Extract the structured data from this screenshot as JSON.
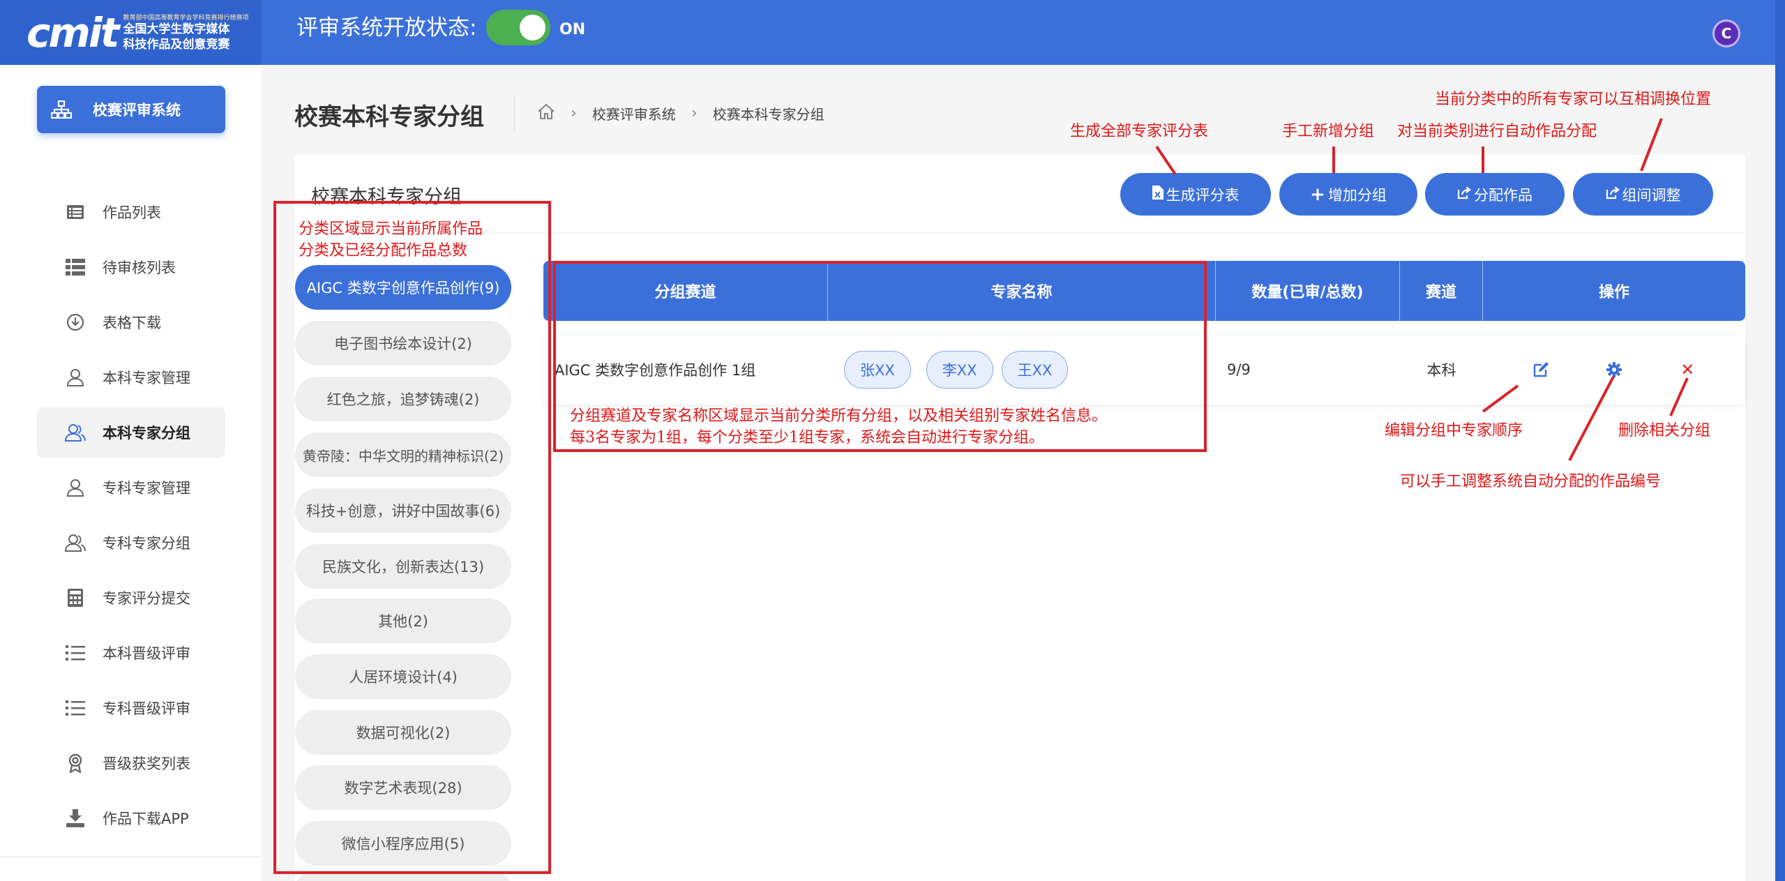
{
  "header": {
    "logo_mark": "cmit",
    "logo_small": "教育部中国高等教育学会学科竞赛排行榜赛项",
    "logo_line1": "全国大学生数字媒体",
    "logo_line2": "科技作品及创意竞赛",
    "status_label": "评审系统开放状态:",
    "toggle_state": "ON",
    "avatar_letter": "C"
  },
  "sidebar": {
    "primary": "校赛评审系统",
    "items": [
      {
        "label": "作品列表",
        "icon": "list-icon"
      },
      {
        "label": "待审核列表",
        "icon": "table-icon"
      },
      {
        "label": "表格下载",
        "icon": "download-circle-icon"
      },
      {
        "label": "本科专家管理",
        "icon": "user-icon"
      },
      {
        "label": "本科专家分组",
        "icon": "users-icon"
      },
      {
        "label": "专科专家管理",
        "icon": "user-icon"
      },
      {
        "label": "专科专家分组",
        "icon": "users-icon"
      },
      {
        "label": "专家评分提交",
        "icon": "calculator-icon"
      },
      {
        "label": "本科晋级评审",
        "icon": "list-ul-icon"
      },
      {
        "label": "专科晋级评审",
        "icon": "list-ul-icon"
      },
      {
        "label": "晋级获奖列表",
        "icon": "award-icon"
      },
      {
        "label": "作品下载APP",
        "icon": "download-icon"
      }
    ]
  },
  "page": {
    "title": "校赛本科专家分组",
    "breadcrumb": [
      "校赛评审系统",
      "校赛本科专家分组"
    ]
  },
  "card": {
    "title": "校赛本科专家分组",
    "buttons": {
      "generate": "生成评分表",
      "add_group": "增加分组",
      "assign": "分配作品",
      "adjust": "组间调整"
    }
  },
  "categories": [
    "AIGC 类数字创意作品创作(9)",
    "电子图书绘本设计(2)",
    "红色之旅，追梦铸魂(2)",
    "黄帝陵：中华文明的精神标识(2)",
    "科技+创意，讲好中国故事(6)",
    "民族文化，创新表达(13)",
    "其他(2)",
    "人居环境设计(4)",
    "数据可视化(2)",
    "数字艺术表现(28)",
    "微信小程序应用(5)"
  ],
  "table": {
    "columns": [
      "分组赛道",
      "专家名称",
      "数量(已审/总数)",
      "赛道",
      "操作"
    ],
    "rows": [
      {
        "group": "AIGC 类数字创意作品创作 1组",
        "experts": [
          "张XX",
          "李XX",
          "王XX"
        ],
        "count": "9/9",
        "track": "本科"
      }
    ]
  },
  "annotations": {
    "category_area": [
      "分类区域显示当前所属作品",
      "分类及已经分配作品总数"
    ],
    "table_area": [
      "分组赛道及专家名称区域显示当前分类所有分组，以及相关组别专家姓名信息。",
      "每3名专家为1组，每个分类至少1组专家，系统会自动进行专家分组。"
    ],
    "generate": "生成全部专家评分表",
    "add_group": "手工新增分组",
    "assign": "对当前类别进行自动作品分配",
    "adjust": "当前分类中的所有专家可以互相调换位置",
    "edit": "编辑分组中专家顺序",
    "settings": "可以手工调整系统自动分配的作品编号",
    "delete": "删除相关分组"
  },
  "colors": {
    "primary": "#3b70db",
    "annotation": "#e01818",
    "toggle_on": "#4caf50"
  }
}
